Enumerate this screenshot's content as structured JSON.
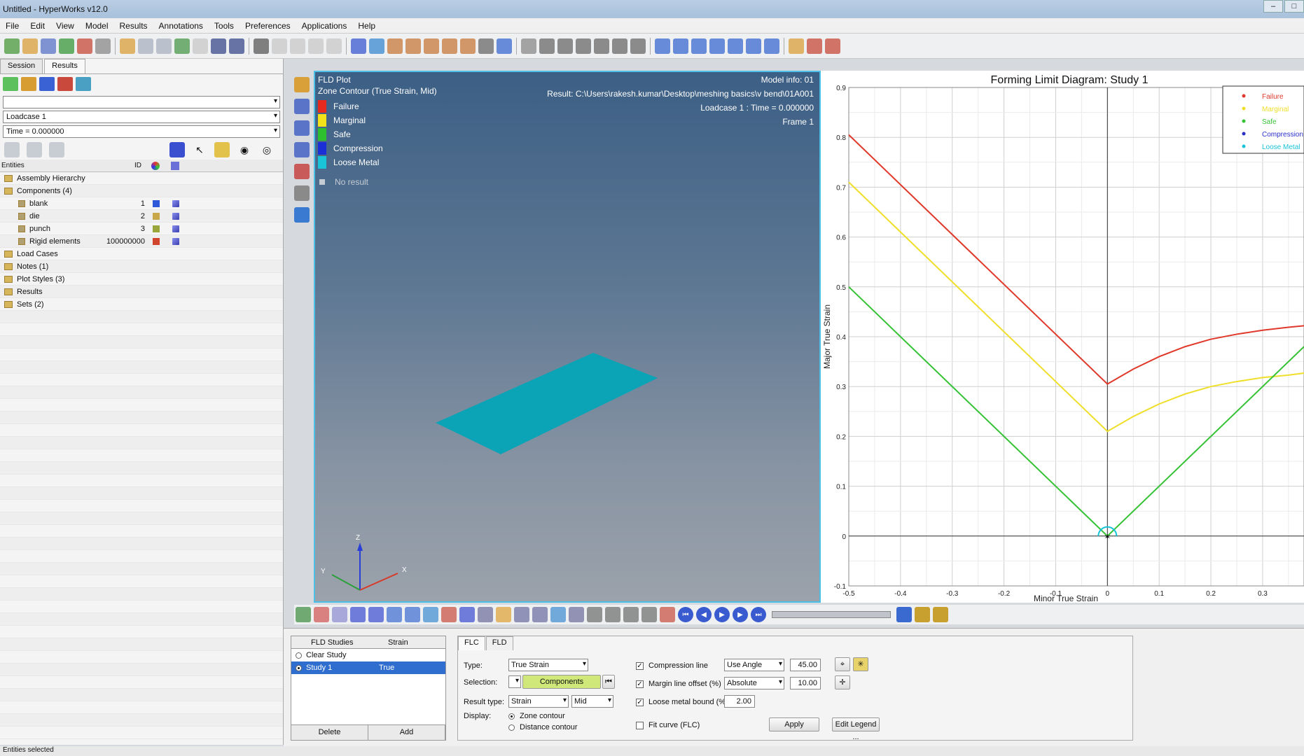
{
  "window": {
    "title": "Untitled - HyperWorks v12.0"
  },
  "menubar": [
    "File",
    "Edit",
    "View",
    "Model",
    "Results",
    "Annotations",
    "Tools",
    "Preferences",
    "Applications",
    "Help"
  ],
  "left_panel": {
    "tabs": [
      "Session",
      "Results"
    ],
    "loadcase": "Loadcase 1",
    "time": "Time = 0.000000",
    "tree_header": {
      "entities": "Entities",
      "id": "ID"
    },
    "tree": [
      {
        "label": "Assembly Hierarchy",
        "indent": 1,
        "id": "",
        "color": ""
      },
      {
        "label": "Components (4)",
        "indent": 1,
        "id": "",
        "color": ""
      },
      {
        "label": "blank",
        "indent": 2,
        "id": "1",
        "color": "#2f59d8"
      },
      {
        "label": "die",
        "indent": 2,
        "id": "2",
        "color": "#c8a64a"
      },
      {
        "label": "punch",
        "indent": 2,
        "id": "3",
        "color": "#9aa63a"
      },
      {
        "label": "Rigid elements",
        "indent": 2,
        "id": "100000000",
        "color": "#d0452c"
      },
      {
        "label": "Load Cases",
        "indent": 1,
        "id": "",
        "color": ""
      },
      {
        "label": "Notes (1)",
        "indent": 1,
        "id": "",
        "color": ""
      },
      {
        "label": "Plot Styles (3)",
        "indent": 1,
        "id": "",
        "color": ""
      },
      {
        "label": "Results",
        "indent": 1,
        "id": "",
        "color": ""
      },
      {
        "label": "Sets (2)",
        "indent": 1,
        "id": "",
        "color": ""
      }
    ]
  },
  "viewport": {
    "title": "FLD Plot",
    "subtitle": "Zone Contour (True Strain, Mid)",
    "model_info": "Model info: 01",
    "result": "Result: C:\\Users\\rakesh.kumar\\Desktop\\meshing basics\\v bend\\01A001",
    "loadcase": "Loadcase 1 : Time = 0.000000",
    "frame": "Frame 1",
    "legend": [
      {
        "label": "Failure",
        "color": "#e62b1e"
      },
      {
        "label": "Marginal",
        "color": "#f2e21a"
      },
      {
        "label": "Safe",
        "color": "#2fc02f"
      },
      {
        "label": "Compression",
        "color": "#1a2fd6"
      },
      {
        "label": "Loose Metal",
        "color": "#19c4d8"
      }
    ],
    "no_result": "No result",
    "axes": {
      "z": "Z",
      "y": "Y",
      "x": "X"
    }
  },
  "chart_data": {
    "type": "line",
    "title": "Forming Limit Diagram: Study 1",
    "xlabel": "Minor True Strain",
    "ylabel": "Major True Strain",
    "xlim": [
      -0.5,
      0.38
    ],
    "ylim": [
      -0.1,
      0.9
    ],
    "xticks": [
      "-0.5",
      "-0.4",
      "-0.3",
      "-0.2",
      "-0.1",
      "0",
      "0.1",
      "0.2",
      "0.3"
    ],
    "yticks": [
      "-0.1",
      "0",
      "0.1",
      "0.2",
      "0.3",
      "0.4",
      "0.5",
      "0.6",
      "0.7",
      "0.8",
      "0.9"
    ],
    "grid": true,
    "legend_position": "top-right",
    "series": [
      {
        "name": "Failure",
        "color": "#e0392b",
        "x": [
          -0.5,
          0,
          0.05,
          0.1,
          0.15,
          0.2,
          0.25,
          0.3,
          0.35,
          0.38
        ],
        "y": [
          0.805,
          0.305,
          0.335,
          0.36,
          0.38,
          0.395,
          0.405,
          0.413,
          0.419,
          0.422
        ]
      },
      {
        "name": "Marginal",
        "color": "#f0df2a",
        "x": [
          -0.5,
          0,
          0.05,
          0.1,
          0.15,
          0.2,
          0.25,
          0.3,
          0.35,
          0.38
        ],
        "y": [
          0.71,
          0.21,
          0.24,
          0.265,
          0.285,
          0.3,
          0.31,
          0.318,
          0.323,
          0.327
        ]
      },
      {
        "name": "Safe",
        "color": "#35c235",
        "x": [
          -0.5,
          0,
          0.38
        ],
        "y": [
          0.5,
          0.0,
          0.38
        ]
      },
      {
        "name": "Compression",
        "color": "#2a2fc8",
        "x": [],
        "y": []
      },
      {
        "name": "Loose Metal",
        "color": "#19c4d8",
        "x": [],
        "y": []
      }
    ]
  },
  "studies": {
    "col1": "FLD Studies",
    "col2": "Strain",
    "rows": [
      {
        "name": "Clear Study",
        "strain": "",
        "selected": false
      },
      {
        "name": "Study 1",
        "strain": "True",
        "selected": true
      }
    ],
    "delete": "Delete",
    "add": "Add"
  },
  "fld_panel": {
    "tabs": [
      "FLC",
      "FLD"
    ],
    "type_label": "Type:",
    "type_value": "True Strain",
    "selection_label": "Selection:",
    "selection_value": "Components",
    "result_type_label": "Result type:",
    "result_type_value": "Strain",
    "result_layer": "Mid",
    "display_label": "Display:",
    "zone_contour": "Zone contour",
    "distance_contour": "Distance contour",
    "compression_line": "Compression line",
    "compression_mode": "Use Angle",
    "compression_value": "45.00",
    "margin_line": "Margin line offset (%)",
    "margin_mode": "Absolute",
    "margin_value": "10.00",
    "loose_metal": "Loose metal bound (%)",
    "loose_value": "2.00",
    "fit_curve": "Fit curve (FLC)",
    "apply": "Apply",
    "edit_legend": "Edit Legend ..."
  },
  "status": "Entities selected"
}
